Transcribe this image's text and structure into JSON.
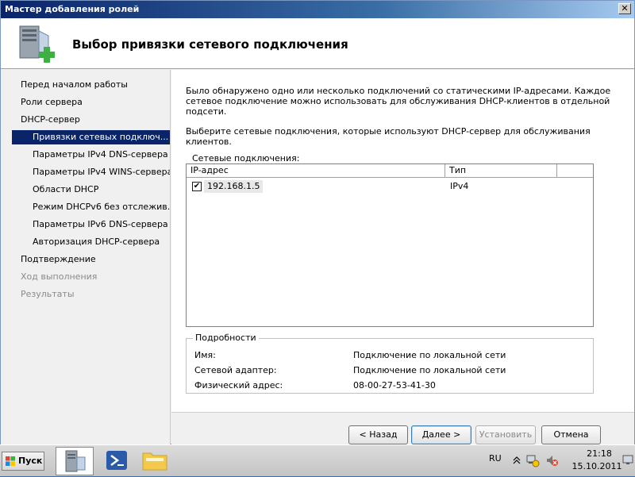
{
  "window": {
    "title": "Мастер добавления ролей",
    "close_glyph": "✕"
  },
  "header": {
    "title": "Выбор привязки сетевого подключения",
    "icon": "server-add-icon"
  },
  "nav": {
    "items": [
      {
        "label": "Перед началом работы",
        "level": 0,
        "state": "normal"
      },
      {
        "label": "Роли сервера",
        "level": 0,
        "state": "normal"
      },
      {
        "label": "DHCP-сервер",
        "level": 0,
        "state": "normal"
      },
      {
        "label": "Привязки сетевых подключ...",
        "level": 1,
        "state": "active"
      },
      {
        "label": "Параметры IPv4 DNS-сервера",
        "level": 1,
        "state": "normal"
      },
      {
        "label": "Параметры IPv4 WINS-сервера",
        "level": 1,
        "state": "normal"
      },
      {
        "label": "Области DHCP",
        "level": 1,
        "state": "normal"
      },
      {
        "label": "Режим DHCPv6 без отслежив...",
        "level": 1,
        "state": "normal"
      },
      {
        "label": "Параметры IPv6 DNS-сервера",
        "level": 1,
        "state": "normal"
      },
      {
        "label": "Авторизация DHCP-сервера",
        "level": 1,
        "state": "normal"
      },
      {
        "label": "Подтверждение",
        "level": 0,
        "state": "normal"
      },
      {
        "label": "Ход выполнения",
        "level": 0,
        "state": "disabled"
      },
      {
        "label": "Результаты",
        "level": 0,
        "state": "disabled"
      }
    ]
  },
  "content": {
    "description": "Было обнаружено одно или несколько подключений со статическими IP-адресами. Каждое сетевое подключение можно использовать для обслуживания DHCP-клиентов в отдельной подсети.",
    "instruction": "Выберите сетевые подключения, которые используют DHCP-сервер для обслуживания клиентов.",
    "connections_label": "Сетевые подключения:",
    "columns": {
      "ip": "IP-адрес",
      "type": "Тип"
    },
    "rows": [
      {
        "checked": true,
        "ip": "192.168.1.5",
        "type": "IPv4"
      }
    ],
    "check_glyph": "✔"
  },
  "details": {
    "legend": "Подробности",
    "rows": [
      {
        "label": "Имя:",
        "value": "Подключение по локальной сети"
      },
      {
        "label": "Сетевой адаптер:",
        "value": "Подключение по локальной сети"
      },
      {
        "label": "Физический адрес:",
        "value": "08-00-27-53-41-30"
      }
    ]
  },
  "buttons": {
    "back": "< Назад",
    "next": "Далее >",
    "install": "Установить",
    "cancel": "Отмена"
  },
  "taskbar": {
    "start_label": "Пуск",
    "apps": [
      "server-manager-icon",
      "powershell-icon",
      "explorer-folder-icon"
    ],
    "language": "RU",
    "time": "21:18",
    "date": "15.10.2011"
  },
  "colors": {
    "selection": "#0a246a",
    "titlebar": "#0a246a"
  }
}
